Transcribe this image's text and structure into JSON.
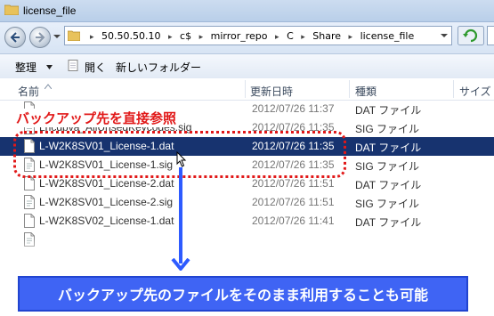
{
  "window": {
    "title": "license_file"
  },
  "address_bar": {
    "crumbs": [
      "50.50.50.10",
      "c$",
      "mirror_repo",
      "C",
      "Share",
      "license_file"
    ]
  },
  "toolbar": {
    "organize_label": "整理",
    "open_label": "開く",
    "new_folder_label": "新しいフォルダー"
  },
  "columns": {
    "name": "名前",
    "date": "更新日時",
    "type": "種類",
    "size": "サイズ"
  },
  "files": [
    {
      "name": "",
      "date": "2012/07/26 11:37",
      "type": "DAT ファイル",
      "icon": "doc-icon"
    },
    {
      "name": "Lhcdpva_AllUnseqKeycodes.sig",
      "date": "2012/07/26 11:35",
      "type": "SIG ファイル",
      "icon": "sig-icon"
    },
    {
      "name": "L-W2K8SV01_License-1.dat",
      "date": "2012/07/26 11:35",
      "type": "DAT ファイル",
      "icon": "doc-icon",
      "selected": true
    },
    {
      "name": "L-W2K8SV01_License-1.sig",
      "date": "2012/07/26 11:35",
      "type": "SIG ファイル",
      "icon": "sig-icon"
    },
    {
      "name": "L-W2K8SV01_License-2.dat",
      "date": "2012/07/26 11:51",
      "type": "DAT ファイル",
      "icon": "doc-icon"
    },
    {
      "name": "L-W2K8SV01_License-2.sig",
      "date": "2012/07/26 11:51",
      "type": "SIG ファイル",
      "icon": "sig-icon"
    },
    {
      "name": "L-W2K8SV02_License-1.dat",
      "date": "2012/07/26 11:41",
      "type": "DAT ファイル",
      "icon": "doc-icon"
    },
    {
      "name": "",
      "date": "",
      "type": "",
      "icon": "sig-icon"
    }
  ],
  "annotation": {
    "label": "バックアップ先を直接参照",
    "label_color": "#e11818",
    "banner": "バックアップ先のファイルをそのまま利用することも可能",
    "banner_color": "#3f64f4"
  }
}
